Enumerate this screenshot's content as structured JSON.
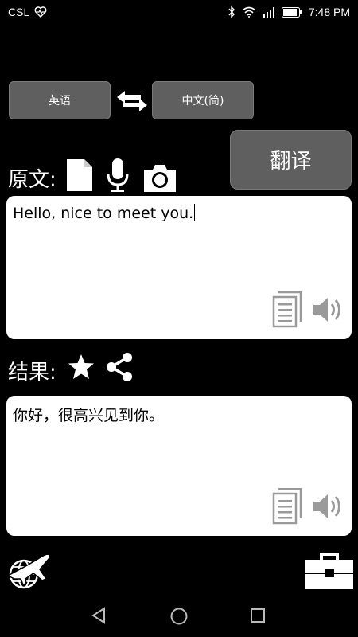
{
  "status_bar": {
    "carrier": "CSL",
    "time": "7:48 PM"
  },
  "languages": {
    "source": "英语",
    "target": "中文(简)"
  },
  "translate_button": "翻译",
  "source_section": {
    "label": "原文:",
    "text": "Hello, nice to meet you."
  },
  "result_section": {
    "label": "结果:",
    "text": "你好，很高兴见到你。"
  },
  "icons": {
    "heart_monitor": "heart-monitor-icon",
    "bluetooth": "bluetooth-icon",
    "wifi": "wifi-icon",
    "signal": "signal-icon",
    "battery": "battery-icon",
    "swap": "swap-arrows-icon",
    "file": "file-icon",
    "mic": "microphone-icon",
    "camera": "camera-icon",
    "copy": "copy-icon",
    "speaker": "speaker-icon",
    "star": "star-icon",
    "share": "share-icon",
    "globe_plane": "globe-plane-icon",
    "toolbox": "toolbox-icon",
    "back": "back-icon",
    "home": "home-icon",
    "recents": "recents-icon"
  },
  "colors": {
    "background": "#000000",
    "button": "#5f5f5f",
    "textbox": "#ffffff",
    "icon_gray": "#9a9a9a"
  }
}
